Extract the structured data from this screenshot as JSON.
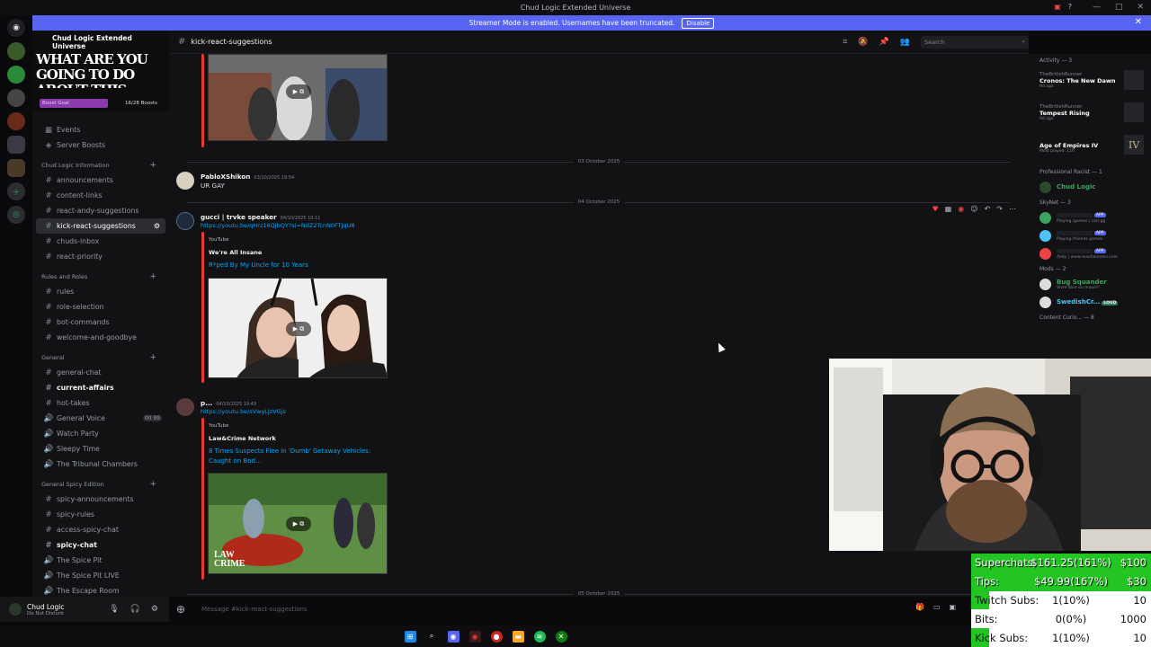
{
  "window": {
    "title": "Chud Logic Extended Universe"
  },
  "streamer_mode": {
    "message": "Streamer Mode is enabled. Usernames have been truncated.",
    "button": "Disable"
  },
  "server": {
    "name": "Chud Logic Extended Universe",
    "banner_text": "WHAT ARE YOU GOING TO DO ABOUT THIS, CHUDLOGIC?",
    "boost_goal": "Boost Goal",
    "boost_count": "16/28 Boosts",
    "boost_fraction": 0.57
  },
  "channels": {
    "top": [
      {
        "icon": "calendar",
        "label": "Events"
      },
      {
        "icon": "boost",
        "label": "Server Boosts"
      }
    ],
    "cat_info": "Chud Logic Information",
    "info": [
      "announcements",
      "content-links",
      "react-andy-suggestions",
      "kick-react-suggestions",
      "chuds-inbox",
      "react-priority"
    ],
    "cat_rules": "Rules and Roles",
    "rules": [
      "rules",
      "role-selection",
      "bot-commands",
      "welcome-and-goodbye"
    ],
    "cat_general": "General",
    "general": [
      "general-chat",
      "current-affairs",
      "hot-takes",
      "General Voice",
      "Watch Party",
      "Sleepy Time",
      "The Tribunal Chambers"
    ],
    "voice_count": "00 99",
    "cat_spicy": "General Spicy Edition",
    "spicy": [
      "spicy-announcements",
      "spicy-rules",
      "access-spicy-chat",
      "spicy-chat",
      "The Spice Pit",
      "The Spice Pit LIVE",
      "The Escape Room"
    ]
  },
  "user_panel": {
    "name": "Chud Logic",
    "status": "Do Not Disturb"
  },
  "header": {
    "channel": "kick-react-suggestions",
    "search_placeholder": "Search"
  },
  "messages": {
    "date1": "03 October 2025",
    "m1": {
      "author": "PabloXShikon",
      "time": "03/10/2025 19:54",
      "text": "UR GAY"
    },
    "date2": "04 October 2025",
    "m2": {
      "author": "gucci | trvke speaker",
      "time": "04/10/2025 10:11",
      "link": "https://youtu.be/qHrz16QjbQY?si=NdZ2TcnN0FTJqU8",
      "provider": "YouTube",
      "channel": "We're All Insane",
      "title": "R*ped By My Uncle for 10 Years"
    },
    "m3": {
      "author": "p...",
      "time": "04/10/2025 19:43",
      "link": "https://youtu.be/sVwyLJzVGjs",
      "provider": "YouTube",
      "channel": "Law&Crime Network",
      "title": "8 Times Suspects Flee in 'Dumb' Getaway Vehicles: Caught on Bod...",
      "thumb_text": "LAW CRIME"
    },
    "date3": "05 October 2025"
  },
  "composer": {
    "placeholder": "Message #kick-react-suggestions"
  },
  "members": {
    "activity": "Activity — 3",
    "activities": [
      {
        "who": "TheBritishRunner",
        "game": "Cronos: The New Dawn",
        "since": "9d ago"
      },
      {
        "who": "TheBritishRunner",
        "game": "Tempest Rising",
        "since": "9d ago"
      },
      {
        "who": "",
        "game": "Age of Empires IV",
        "since": "Most played: 11h",
        "art": "IV"
      }
    ],
    "role_racist": "Professional Racist — 1",
    "racist_member": "Chud Logic",
    "role_skynet": "SkyNet — 3",
    "skynet": [
      {
        "status": "Playing /games | carl.gg",
        "tag": "APP"
      },
      {
        "status": "Playing /friends games",
        "tag": "APP"
      },
      {
        "status": "/help | www.reactionroles.com",
        "tag": "APP"
      }
    ],
    "role_mods": "Mods — 2",
    "mods": [
      {
        "name": "Bug Squander",
        "status": "Vivre libre ou mourir!",
        "color": "#3ba55d"
      },
      {
        "name": "SwedishCr...",
        "status": "",
        "color": "#4fc3f7",
        "tag": "LOUD"
      }
    ],
    "role_more": "Content Curio... — 8"
  },
  "overlay": {
    "rows": [
      {
        "label": "Superchats:",
        "value": "$161.25(161%)",
        "goal": "$100",
        "fill": 1.0
      },
      {
        "label": "Tips:",
        "value": "$49.99(167%)",
        "goal": "$30",
        "fill": 1.0
      },
      {
        "label": "Twitch Subs:",
        "value": "1(10%)",
        "goal": "10",
        "fill": 0.1
      },
      {
        "label": "Bits:",
        "value": "0(0%)",
        "goal": "1000",
        "fill": 0.0
      },
      {
        "label": "Kick Subs:",
        "value": "1(10%)",
        "goal": "10",
        "fill": 0.1
      }
    ],
    "accent": "#22c522"
  },
  "taskbar": {
    "icons": [
      "windows-start-icon",
      "search-icon",
      "discord-icon",
      "obs-icon",
      "chrome-icon",
      "explorer-icon",
      "spotify-icon",
      "xbox-icon"
    ]
  }
}
